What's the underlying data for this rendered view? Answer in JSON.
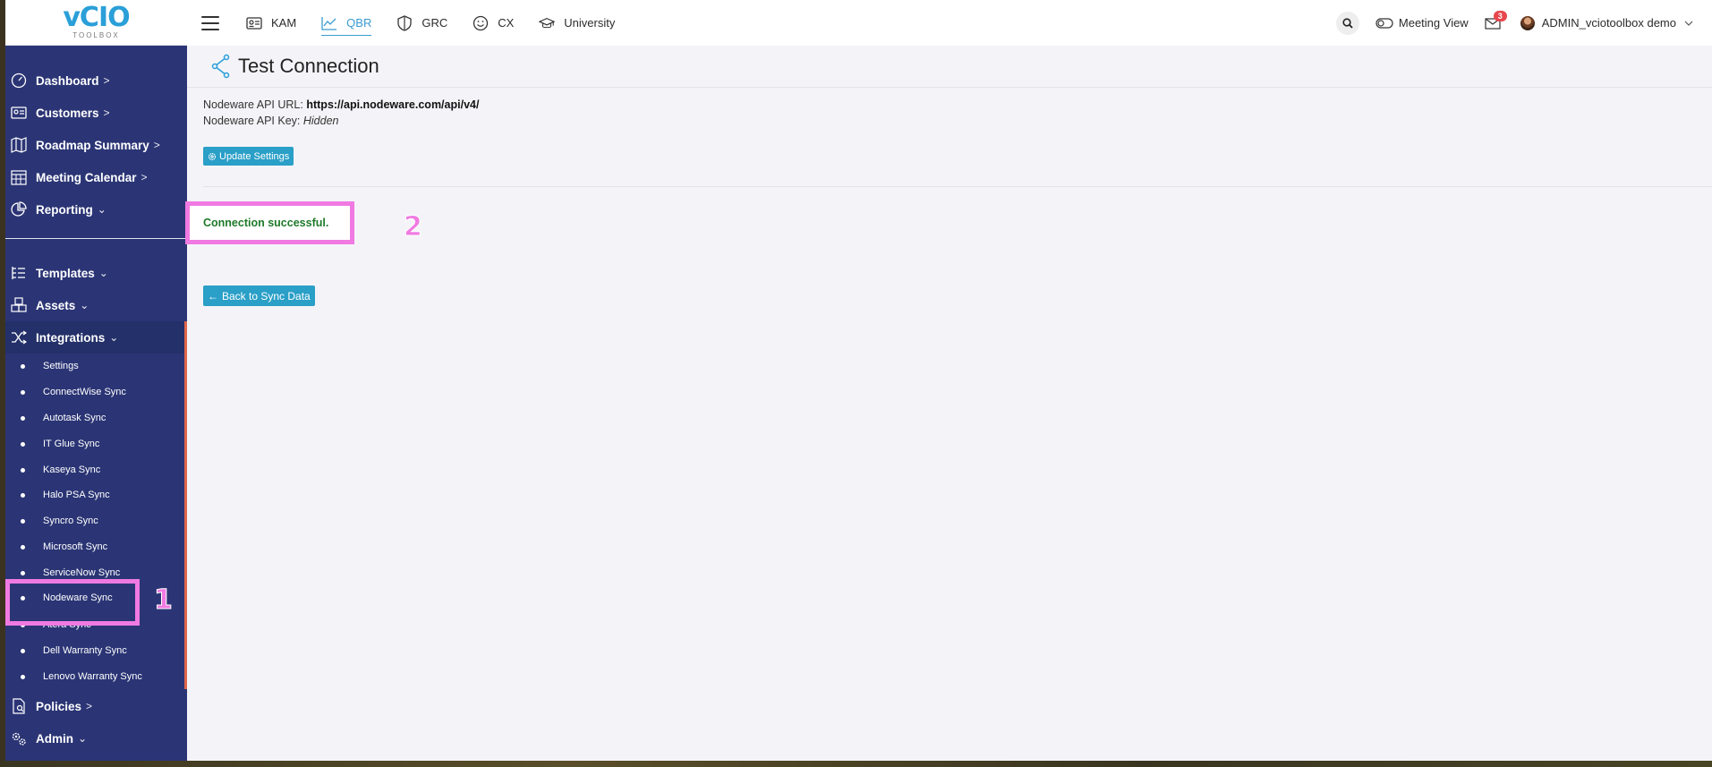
{
  "logo": {
    "mark": "vCIO",
    "sub": "TOOLBOX"
  },
  "topbar": {
    "tabs": [
      {
        "label": "KAM",
        "icon": "id-card-icon"
      },
      {
        "label": "QBR",
        "icon": "chart-line-icon",
        "active": true
      },
      {
        "label": "GRC",
        "icon": "shield-icon"
      },
      {
        "label": "CX",
        "icon": "smiley-icon"
      },
      {
        "label": "University",
        "icon": "graduation-cap-icon"
      }
    ],
    "search_label": "Q..",
    "meeting_view": "Meeting View",
    "mail_count": "3",
    "user_name": "ADMIN_vciotoolbox demo"
  },
  "sidebar": {
    "items": [
      {
        "label": "Dashboard",
        "chev": ">"
      },
      {
        "label": "Customers",
        "chev": ">"
      },
      {
        "label": "Roadmap Summary",
        "chev": ">"
      },
      {
        "label": "Meeting Calendar",
        "chev": ">"
      },
      {
        "label": "Reporting",
        "chev": "⌄"
      },
      {
        "label": "Templates",
        "chev": "⌄"
      },
      {
        "label": "Assets",
        "chev": "⌄"
      },
      {
        "label": "Integrations",
        "chev": "⌄"
      },
      {
        "label": "Policies",
        "chev": ">"
      },
      {
        "label": "Admin",
        "chev": "⌄"
      }
    ],
    "sub_items": [
      "Settings",
      "ConnectWise Sync",
      "Autotask Sync",
      "IT Glue Sync",
      "Kaseya Sync",
      "Halo PSA Sync",
      "Syncro Sync",
      "Microsoft Sync",
      "ServiceNow Sync",
      "Nodeware Sync",
      "Atera Sync",
      "Dell Warranty Sync",
      "Lenovo Warranty Sync"
    ]
  },
  "main": {
    "title": "Test Connection",
    "api_url_label": "Nodeware API URL: ",
    "api_url_value": "https://api.nodeware.com/api/v4/",
    "api_key_label": "Nodeware API Key: ",
    "api_key_value": "Hidden",
    "update_button": "Update Settings",
    "success_message": "Connection successful.",
    "back_button": "Back to Sync Data"
  },
  "annotations": {
    "one": "1",
    "two": "2"
  },
  "colors": {
    "sidebar": "#2b3575",
    "accent": "#2a9fc7",
    "highlight": "#f07ae2",
    "success": "#1e7a2a"
  }
}
